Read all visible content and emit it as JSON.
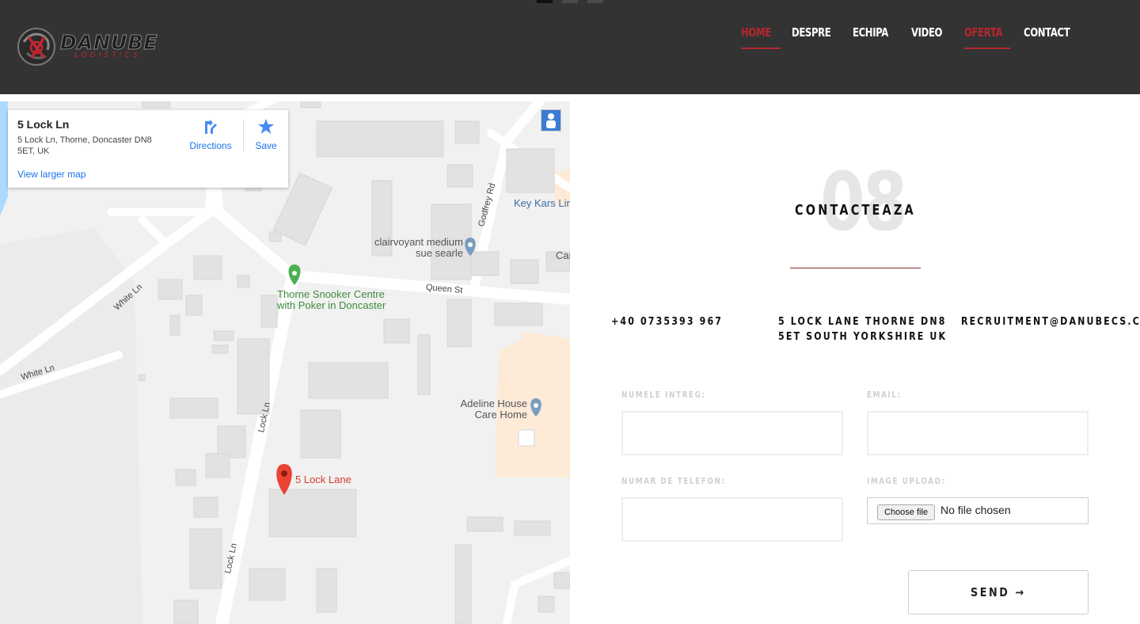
{
  "header": {
    "brand_name": "DANUBE",
    "brand_sub": "LOGISTICS",
    "nav": [
      {
        "label": "HOME",
        "active": true
      },
      {
        "label": "DESPRE"
      },
      {
        "label": "ECHIPA"
      },
      {
        "label": "VIDEO"
      },
      {
        "label": "OFERTA",
        "active": true
      },
      {
        "label": "CONTACT"
      }
    ]
  },
  "map": {
    "card": {
      "title": "5 Lock Ln",
      "address": "5 Lock Ln, Thorne, Doncaster DN8 5ET, UK",
      "larger_map": "View larger map",
      "directions": "Directions",
      "save": "Save"
    },
    "labels": {
      "key_kars": "Key Kars Lin",
      "clairvoyant": "clairvoyant medium sue searle",
      "car": "Car",
      "snooker": "Thorne Snooker Centre with Poker in Doncaster",
      "adeline": "Adeline House Care Home",
      "lock_lane": "5 Lock Lane"
    },
    "roads": {
      "godfrey": "Godfrey Rd",
      "queen": "Queen St",
      "white1": "White Ln",
      "white2": "White Ln",
      "lock1": "Lock Ln",
      "lock2": "Lock Ln"
    }
  },
  "contact": {
    "number": "08",
    "title": "CONTACTEAZA",
    "phone": "+40 0735393 967",
    "address_line1": "5 LOCK LANE THORNE DN8",
    "address_line2": "5ET SOUTH YORKSHIRE UK",
    "email": "RECRUITMENT@DANUBECS.CO.UK",
    "form": {
      "name_label": "NUMELE INTREG:",
      "email_label": "EMAIL:",
      "phone_label": "NUMAR DE TELEFON:",
      "upload_label": "IMAGE UPLOAD:",
      "file_button": "Choose file",
      "file_status": "No file chosen",
      "send_label": "SEND →"
    }
  },
  "colors": {
    "header_bg": "#333333",
    "accent_red": "#b5272d",
    "map_bg": "#f1f1f1"
  }
}
